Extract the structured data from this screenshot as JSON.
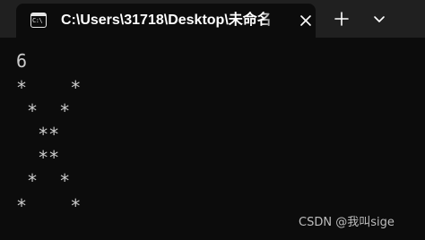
{
  "tab": {
    "title": "C:\\Users\\31718\\Desktop\\未命名",
    "icon": "terminal-icon",
    "icon_glyph": "C:\\"
  },
  "toolbar": {
    "close_icon": "close-icon",
    "new_tab_icon": "plus-icon",
    "dropdown_icon": "chevron-down-icon"
  },
  "console": {
    "lines": [
      "6",
      "*    *",
      " *  *",
      "  **",
      "  **",
      " *  *",
      "*    *"
    ]
  },
  "watermark": "CSDN @我叫sige",
  "colors": {
    "background": "#0c0c0c",
    "tabbar": "#202020",
    "text": "#cccccc"
  }
}
